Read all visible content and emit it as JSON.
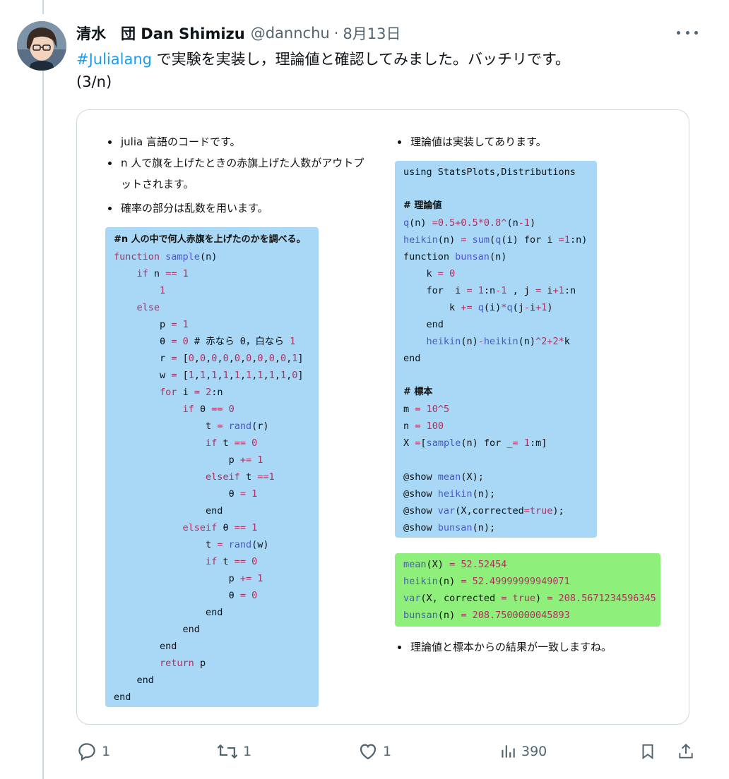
{
  "post": {
    "display_name": "清水　団 Dan Shimizu",
    "handle": "@dannchu",
    "separator": "·",
    "date": "8月13日",
    "hashtag": "#Julialang",
    "text_rest": " で実験を実装し，理論値と確認してみました。バッチリです。",
    "text_line2": "(3/n)"
  },
  "card": {
    "left_bullets": [
      "julia 言語のコードです。",
      "n 人で旗を上げたときの赤旗上げた人数がアウトプットされます。",
      "確率の部分は乱数を用います。"
    ],
    "left_code": [
      "#n 人の中で何人赤旗を上げたのかを調べる。",
      "function sample(n)",
      "    if n == 1",
      "        1",
      "    else",
      "        p = 1",
      "        θ = 0 # 赤なら 0，白なら 1",
      "        r = [0,0,0,0,0,0,0,0,0,1]",
      "        w = [1,1,1,1,1,1,1,1,1,0]",
      "        for i = 2:n",
      "            if θ == 0",
      "                t = rand(r)",
      "                if t == 0",
      "                    p += 1",
      "                elseif t ==1",
      "                    θ = 1",
      "                end",
      "            elseif θ == 1",
      "                t = rand(w)",
      "                if t == 0",
      "                    p += 1",
      "                    θ = 0",
      "                end",
      "            end",
      "        end",
      "        return p",
      "    end",
      "end"
    ],
    "right_bullet_top": "理論値は実装してあります。",
    "right_code": [
      "using StatsPlots,Distributions",
      "",
      "# 理論値",
      "q(n) =0.5+0.5*0.8^(n-1)",
      "heikin(n) = sum(q(i) for i =1:n)",
      "function bunsan(n)",
      "    k = 0",
      "    for  i = 1:n-1 , j = i+1:n",
      "        k += q(i)*q(j-i+1)",
      "    end",
      "    heikin(n)-heikin(n)^2+2*k",
      "end",
      "",
      "# 標本",
      "m = 10^5",
      "n = 100",
      "X =[sample(n) for _= 1:m]",
      "",
      "@show mean(X);",
      "@show heikin(n);",
      "@show var(X,corrected=true);",
      "@show bunsan(n);"
    ],
    "output": [
      "mean(X) = 52.52454",
      "heikin(n) = 52.49999999949071",
      "var(X, corrected = true) = 208.5671234596345",
      "bunsan(n) = 208.7500000045893"
    ],
    "right_bullet_bottom": "理論値と標本からの結果が一致しますね。"
  },
  "actions": {
    "reply_count": "1",
    "repost_count": "1",
    "like_count": "1",
    "views_count": "390"
  },
  "colors": {
    "code_blue": "#a8d8f5",
    "output_green": "#8ef07b",
    "link_blue": "#1d9bf0",
    "keyword": "#b03060",
    "function": "#4d56c8"
  }
}
